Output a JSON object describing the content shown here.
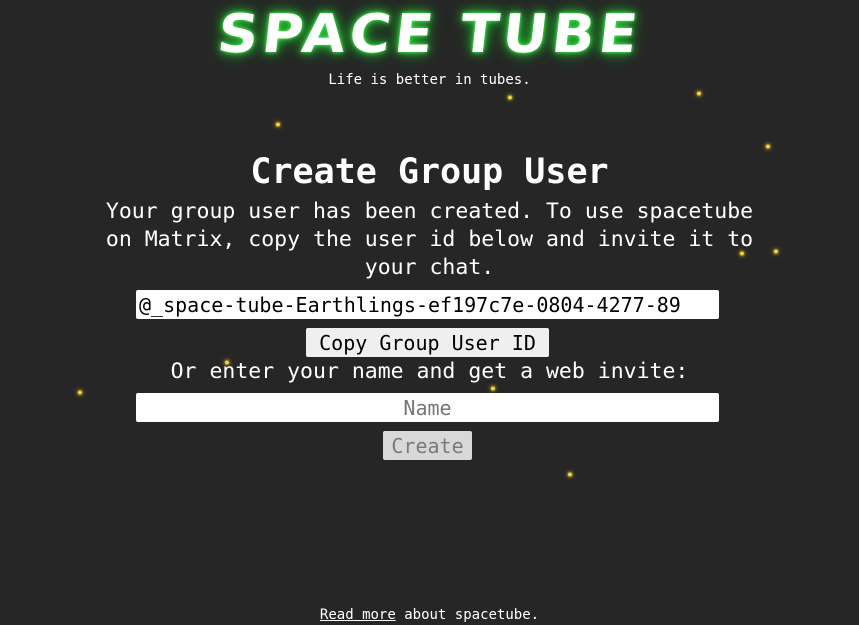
{
  "logo": {
    "text": "SPACE TUBE",
    "glow_color": "#2fd43c"
  },
  "tagline": "Life is better in tubes.",
  "page_title": "Create Group User",
  "description": "Your group user has been created. To use spacetube on Matrix, copy the user id below and invite it to your chat.",
  "group_user": {
    "user_id_value": "@_space-tube-Earthlings-ef197c7e-0804-4277-89",
    "copy_label": "Copy Group User ID"
  },
  "web_invite": {
    "prompt": "Or enter your name and get a web invite:",
    "name_placeholder": "Name",
    "name_value": "",
    "create_label": "Create"
  },
  "footer": {
    "link_text": "Read more",
    "rest_text": " about spacetube."
  },
  "colors": {
    "background": "#262626",
    "star": "#f7d83a",
    "text": "#ffffff"
  },
  "decorations": {
    "star_icon": "star-icon"
  }
}
